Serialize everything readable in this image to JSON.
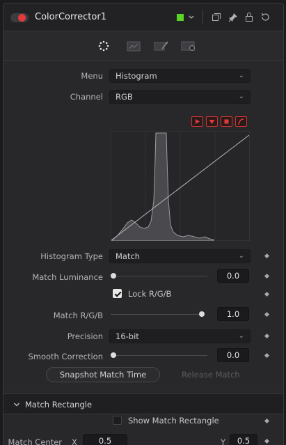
{
  "header": {
    "title": "ColorCorrector1",
    "accent_color": "#e23a3a",
    "swatch_color": "#5ad424"
  },
  "tabs": [
    {
      "name": "color-tab-icon",
      "active": true
    },
    {
      "name": "levels-tab-icon",
      "active": false
    },
    {
      "name": "options-tab-icon",
      "active": false
    },
    {
      "name": "settings-tab-icon",
      "active": false
    }
  ],
  "controls": {
    "menu": {
      "label": "Menu",
      "value": "Histogram"
    },
    "channel": {
      "label": "Channel",
      "value": "RGB"
    },
    "histogram_type": {
      "label": "Histogram Type",
      "value": "Match"
    },
    "match_luminance": {
      "label": "Match Luminance",
      "value": "0.0",
      "level": 0.0
    },
    "lock_rgb": {
      "label": "Lock R/G/B",
      "checked": true
    },
    "match_rgb": {
      "label": "Match R/G/B",
      "value": "1.0",
      "level": 1.0
    },
    "precision": {
      "label": "Precision",
      "value": "16-bit"
    },
    "smooth_correction": {
      "label": "Smooth Correction",
      "value": "0.0",
      "level": 0.0
    },
    "snapshot_button": "Snapshot Match Time",
    "release_button": "Release Match"
  },
  "match_rectangle": {
    "section_label": "Match Rectangle",
    "show_label": "Show Match Rectangle",
    "show_checked": false,
    "center_label": "Match Center",
    "x_label": "X",
    "x_value": "0.5",
    "y_label": "Y",
    "y_value": "0.5"
  }
}
